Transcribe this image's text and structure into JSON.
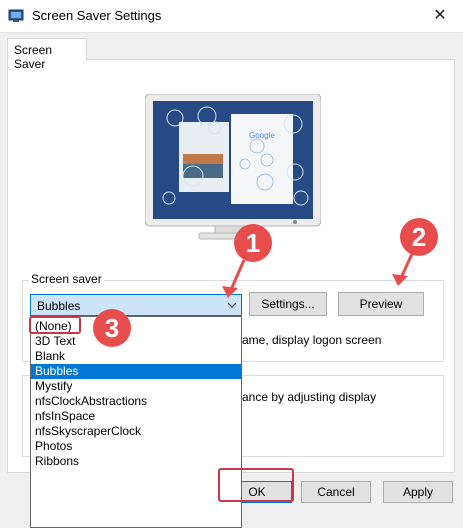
{
  "window": {
    "title": "Screen Saver Settings",
    "close_glyph": "✕",
    "icon": "screen-saver-settings-icon"
  },
  "tabs": [
    {
      "label": "Screen Saver"
    }
  ],
  "preview": {
    "icon": "monitor-preview"
  },
  "screen_saver_group": {
    "label": "Screen saver",
    "selected": "Bubbles",
    "settings_button": "Settings...",
    "preview_button": "Preview",
    "resume_text_partial": "ame, display logon screen",
    "options": [
      "(None)",
      "3D Text",
      "Blank",
      "Bubbles",
      "Mystify",
      "nfsClockAbstractions",
      "nfsInSpace",
      "nfsSkyscraperClock",
      "Photos",
      "Ribbons"
    ]
  },
  "power_group": {
    "text_partial": "ance by adjusting display"
  },
  "footer": {
    "ok": "OK",
    "cancel": "Cancel",
    "apply": "Apply"
  },
  "annotations": {
    "step1": "1",
    "step2": "2",
    "step3": "3"
  },
  "colors": {
    "highlight": "#0078d7",
    "annotation_red": "#e84d4d",
    "combo_bg": "#cce4f7"
  }
}
